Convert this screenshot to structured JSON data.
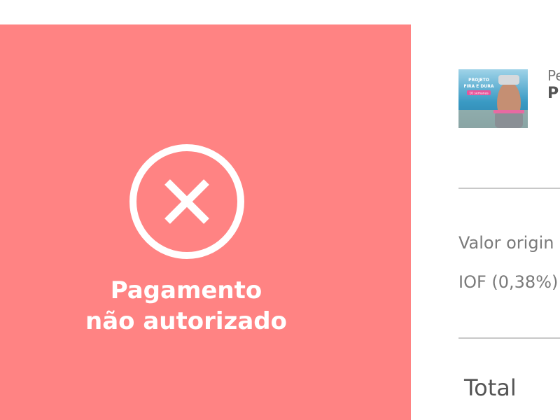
{
  "status": {
    "title_line1": "Pagamento",
    "title_line2": "não autorizado",
    "icon": "close-circle-icon",
    "background_color": "#ff8383"
  },
  "order": {
    "product_prefix": "Pe",
    "product_name_fragment": "P",
    "product_image_text": {
      "line1": "PROJETO",
      "line2": "FIRA E DURA",
      "badge": "10 semanas"
    },
    "original_value_label": "Valor origin",
    "iof_label": "IOF (0,38%)",
    "total_label": "Total"
  }
}
